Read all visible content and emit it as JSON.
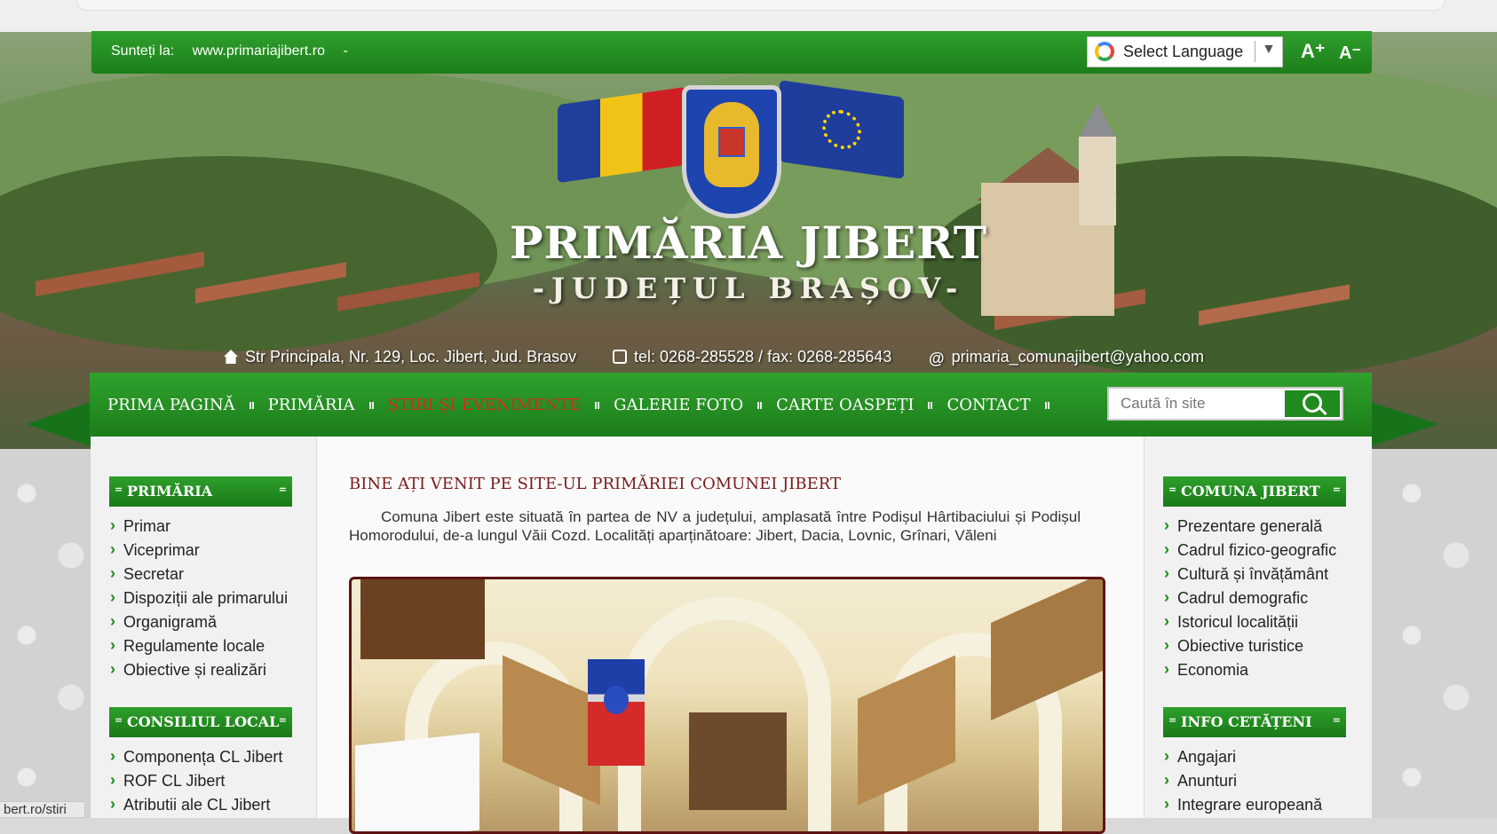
{
  "topbar": {
    "location_label": "Sunteți la:",
    "location_url": "www.primariajibert.ro",
    "location_sep": "-",
    "language_select": "Select Language",
    "language_arrow": "▼",
    "font_increase": "A⁺",
    "font_decrease": "A⁻"
  },
  "header": {
    "title": "PRIMĂRIA JIBERT",
    "subtitle": "-JUDEȚUL  BRAȘOV-",
    "address": "Str Principala, Nr. 129, Loc. Jibert, Jud. Brasov",
    "phone": "tel: 0268-285528 / fax: 0268-285643",
    "email_prefix": "@",
    "email": "primaria_comunajibert@yahoo.com"
  },
  "nav": {
    "items": [
      {
        "label": "PRIMA PAGINĂ"
      },
      {
        "label": "PRIMĂRIA"
      },
      {
        "label": "ȘTIRI ȘI EVENIMENTE"
      },
      {
        "label": "GALERIE FOTO"
      },
      {
        "label": "CARTE OASPEȚI"
      },
      {
        "label": "CONTACT"
      }
    ],
    "active_index": 2,
    "search_placeholder": "Caută în site"
  },
  "left_sidebar": {
    "primaria": {
      "title": "PRIMĂRIA",
      "items": [
        "Primar",
        "Viceprimar",
        "Secretar",
        "Dispoziții ale primarului",
        "Organigramă",
        "Regulamente locale",
        "Obiective și realizări"
      ]
    },
    "consiliul": {
      "title": "CONSILIUL LOCAL",
      "items": [
        "Componența CL Jibert",
        "ROF CL Jibert",
        "Atributii ale CL Jibert"
      ]
    }
  },
  "main": {
    "welcome_title": "BINE AȚI VENIT PE SITE-UL PRIMĂRIEI COMUNEI JIBERT",
    "intro": "Comuna Jibert este situată în partea de NV a județului, amplasată între Podișul Hârtibaciului și Podișul Homorodului, de-a lungul Văii Cozd. Localități aparținătoare: Jibert, Dacia, Lovnic, Grînari, Văleni"
  },
  "right_sidebar": {
    "comuna": {
      "title": "COMUNA JIBERT",
      "items": [
        "Prezentare generală",
        "Cadrul fizico-geografic",
        "Cultură și învățământ",
        "Cadrul demografic",
        "Istoricul localității",
        "Obiective turistice",
        "Economia"
      ]
    },
    "info": {
      "title": "INFO CETĂȚENI",
      "items": [
        "Angajari",
        "Anunturi",
        "Integrare europeană"
      ]
    }
  },
  "status_bar": {
    "url": "bert.ro/stiri"
  },
  "colors": {
    "nav_green": "#1f8a1d",
    "active_nav": "#d42b1b",
    "heading_maroon": "#7a1b1b"
  }
}
